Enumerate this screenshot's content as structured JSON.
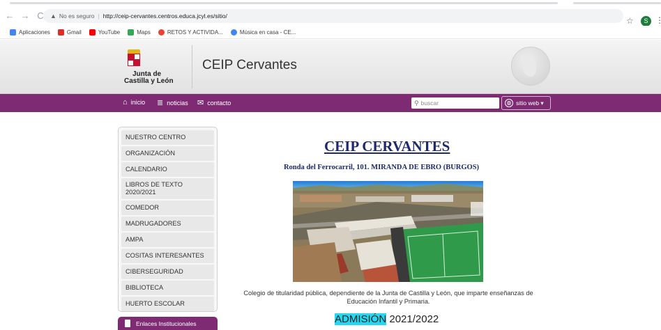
{
  "browser": {
    "nav": {
      "back": "←",
      "forward": "→",
      "reload": "C"
    },
    "security_label": "No es seguro",
    "url": "http://ceip-cervantes.centros.educa.jcyl.es/sitio/",
    "profile_initial": "S",
    "bookmarks": [
      {
        "label": "Aplicaciones",
        "color": "#4285f4"
      },
      {
        "label": "Gmail",
        "color": "#d93025"
      },
      {
        "label": "YouTube",
        "color": "#ff0000"
      },
      {
        "label": "Maps",
        "color": "#34a853"
      },
      {
        "label": "RETOS Y ACTIVIDA...",
        "color": "#ea4335"
      },
      {
        "label": "Música en casa - CE...",
        "color": "#4285f4"
      }
    ]
  },
  "header": {
    "logo_line1": "Junta de",
    "logo_line2": "Castilla y León",
    "site_title": "CEIP Cervantes"
  },
  "navbar": {
    "inicio": "inicio",
    "noticias": "noticias",
    "contacto": "contacto",
    "search_placeholder": "buscar",
    "site_button": "sitio web ▾"
  },
  "sidebar": {
    "items": [
      "NUESTRO CENTRO",
      "ORGANIZACIÓN",
      "CALENDARIO",
      "LIBROS DE TEXTO",
      "2020/2021",
      "COMEDOR",
      "MADRUGADORES",
      "AMPA",
      "COSITAS INTERESANTES",
      "CIBERSEGURIDAD",
      "BIBLIOTECA",
      "HUERTO ESCOLAR"
    ],
    "enlaces": "Enlaces Institucionales"
  },
  "main": {
    "title": "CEIP CERVANTES",
    "address": "Ronda del Ferrocarril, 101. MIRANDA DE EBRO (BURGOS)",
    "description_line1": "Colegio de titularidad pública, dependiente de la Junta de Castilla y León, que imparte enseñanzas de",
    "description_line2": "Educación Infantil y Primaria.",
    "admision_word": "ADMISIÓN",
    "admision_year": "2021/2022"
  },
  "colors": {
    "brand_purple": "#7e2b74",
    "title_blue": "#1f2a6e",
    "highlight": "#26d7f2"
  }
}
